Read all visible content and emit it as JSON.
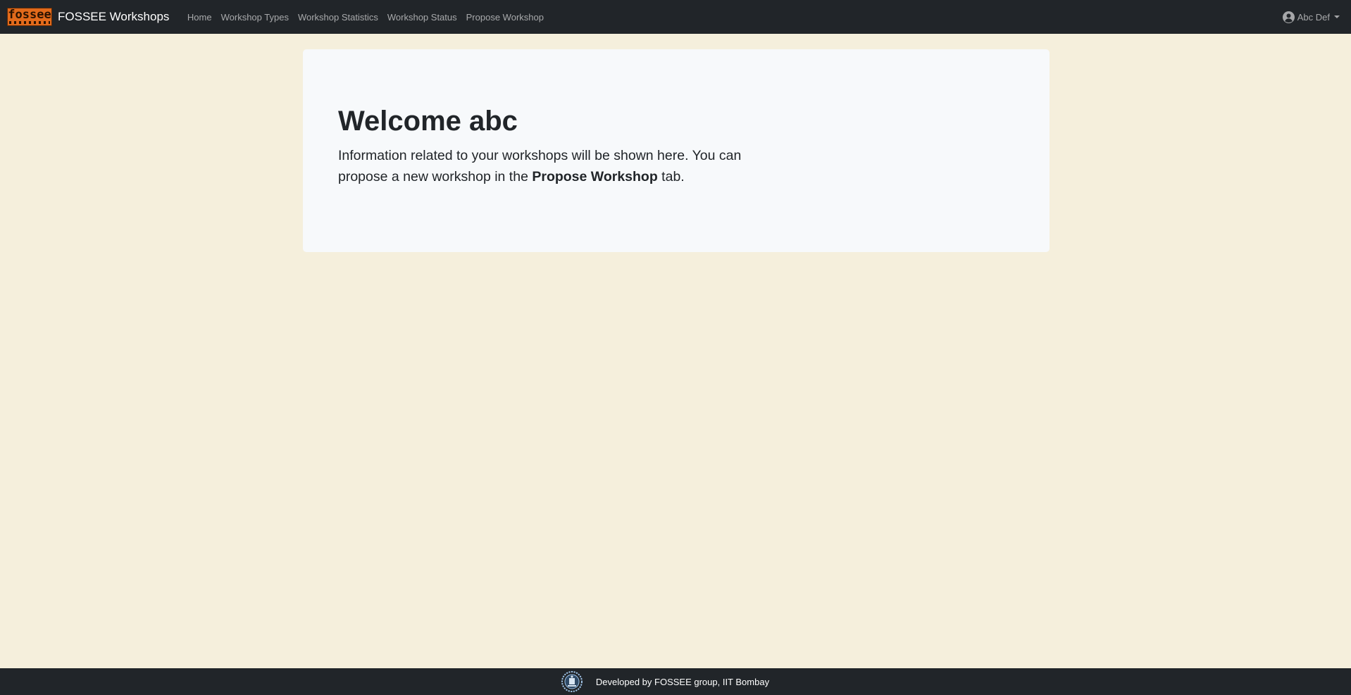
{
  "navbar": {
    "logo_text": "fossee",
    "brand": "FOSSEE Workshops",
    "links": [
      "Home",
      "Workshop Types",
      "Workshop Statistics",
      "Workshop Status",
      "Propose Workshop"
    ],
    "user": {
      "name": "Abc Def",
      "icon": "user-circle-icon"
    }
  },
  "main": {
    "title": "Welcome abc",
    "text_before": "Information related to your workshops will be shown here. You can propose a new workshop in the ",
    "text_bold": "Propose Workshop",
    "text_after": " tab."
  },
  "footer": {
    "logo_icon": "iit-bombay-emblem-icon",
    "text": "Developed by FOSSEE group, IIT Bombay"
  },
  "colors": {
    "page_background": "#f5efdc",
    "navbar_background": "#212529",
    "card_background": "#f7f9fb",
    "logo_orange": "#e26a1b"
  }
}
